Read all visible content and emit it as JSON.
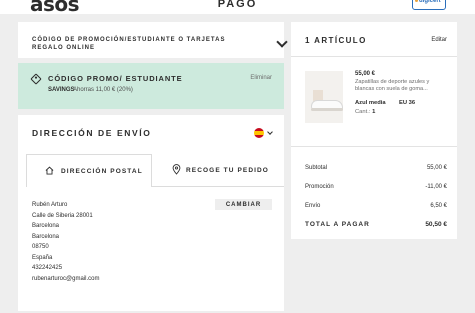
{
  "header": {
    "logo": "asos",
    "title": "PAGO",
    "badge": "digicert"
  },
  "promo": {
    "title": "CÓDIGO DE PROMOCIÓN/ESTUDIANTE O TARJETAS REGALO ONLINE",
    "applied_title": "CÓDIGO PROMO/ ESTUDIANTE",
    "remove_label": "Eliminar",
    "code": "SAVINGS",
    "saving_text": "Ahorras 11,00 € (20%)"
  },
  "shipping": {
    "title": "DIRECCIÓN DE ENVÍO",
    "tabs": [
      {
        "label": "DIRECCIÓN POSTAL",
        "icon": "home-icon",
        "selected": true
      },
      {
        "label": "RECOGE TU PEDIDO",
        "icon": "location-pin-icon",
        "selected": false
      }
    ],
    "change_label": "CAMBIAR",
    "address": [
      "Rubén Arturo",
      "Calle de Siberia 28001",
      "Barcelona",
      "Barcelona",
      "08750",
      "España",
      "432242425",
      "rubenarturoc@gmail.com"
    ]
  },
  "summary": {
    "title": "1 ARTÍCULO",
    "edit_label": "Editar",
    "product": {
      "price": "55,00 €",
      "name": "Zapatillas de deporte azules y blancas con suela de goma...",
      "color": "Azul media",
      "size": "EU 36",
      "qty_label": "Cant.:",
      "qty": "1"
    },
    "rows": [
      {
        "label": "Subtotal",
        "value": "55,00 €"
      },
      {
        "label": "Promoción",
        "value": "-11,00 €"
      },
      {
        "label": "Envío",
        "value": "6,50 €"
      }
    ],
    "total": {
      "label": "TOTAL A PAGAR",
      "value": "50,50 €"
    }
  },
  "colors": {
    "background": "#eeeeee",
    "promo_applied": "#cdeadd",
    "text": "#2d2d2d"
  }
}
